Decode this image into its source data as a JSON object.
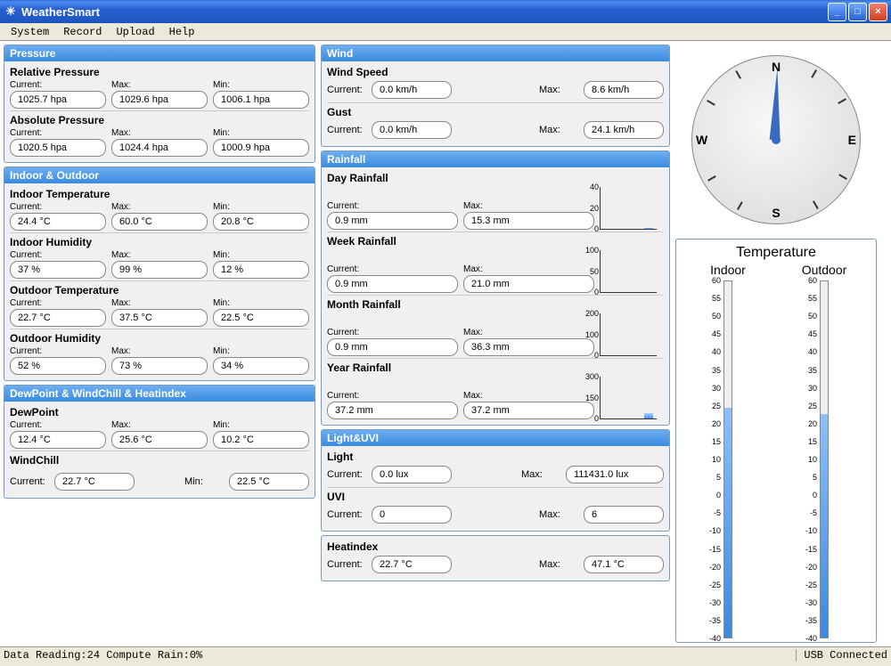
{
  "app": {
    "title": "WeatherSmart"
  },
  "menu": {
    "system": "System",
    "record": "Record",
    "upload": "Upload",
    "help": "Help"
  },
  "labels": {
    "current": "Current:",
    "max": "Max:",
    "min": "Min:"
  },
  "pressure": {
    "header": "Pressure",
    "relative": {
      "title": "Relative Pressure",
      "current": "1025.7 hpa",
      "max": "1029.6 hpa",
      "min": "1006.1 hpa"
    },
    "absolute": {
      "title": "Absolute Pressure",
      "current": "1020.5 hpa",
      "max": "1024.4 hpa",
      "min": "1000.9 hpa"
    }
  },
  "inout": {
    "header": "Indoor & Outdoor",
    "indoor_temp": {
      "title": "Indoor Temperature",
      "current": "24.4 °C",
      "max": "60.0 °C",
      "min": "20.8 °C"
    },
    "indoor_hum": {
      "title": "Indoor Humidity",
      "current": "37 %",
      "max": "99 %",
      "min": "12 %"
    },
    "outdoor_temp": {
      "title": "Outdoor Temperature",
      "current": "22.7 °C",
      "max": "37.5 °C",
      "min": "22.5 °C"
    },
    "outdoor_hum": {
      "title": "Outdoor Humidity",
      "current": "52 %",
      "max": "73 %",
      "min": "34 %"
    }
  },
  "dwh": {
    "header": "DewPoint & WindChill & Heatindex",
    "dewpoint": {
      "title": "DewPoint",
      "current": "12.4 °C",
      "max": "25.6 °C",
      "min": "10.2 °C"
    },
    "windchill": {
      "title": "WindChill",
      "current": "22.7 °C",
      "min": "22.5 °C"
    }
  },
  "wind": {
    "header": "Wind",
    "speed": {
      "title": "Wind Speed",
      "current": "0.0 km/h",
      "max": "8.6 km/h"
    },
    "gust": {
      "title": "Gust",
      "current": "0.0 km/h",
      "max": "24.1 km/h"
    }
  },
  "rainfall": {
    "header": "Rainfall",
    "day": {
      "title": "Day Rainfall",
      "current": "0.9 mm",
      "max": "15.3 mm",
      "scale_top": "40",
      "scale_mid": "20",
      "scale_bot": "0"
    },
    "week": {
      "title": "Week Rainfall",
      "current": "0.9 mm",
      "max": "21.0 mm",
      "scale_top": "100",
      "scale_mid": "50",
      "scale_bot": "0"
    },
    "month": {
      "title": "Month Rainfall",
      "current": "0.9 mm",
      "max": "36.3 mm",
      "scale_top": "200",
      "scale_mid": "100",
      "scale_bot": "0"
    },
    "year": {
      "title": "Year Rainfall",
      "current": "37.2 mm",
      "max": "37.2 mm",
      "scale_top": "300",
      "scale_mid": "150",
      "scale_bot": "0"
    }
  },
  "light": {
    "header": "Light&UVI",
    "light": {
      "title": "Light",
      "current": "0.0 lux",
      "max": "111431.0 lux"
    },
    "uvi": {
      "title": "UVI",
      "current": "0",
      "max": "6"
    }
  },
  "heatindex": {
    "title": "Heatindex",
    "current": "22.7 °C",
    "max": "47.1 °C"
  },
  "compass": {
    "n": "N",
    "s": "S",
    "e": "E",
    "w": "W"
  },
  "temp_panel": {
    "title": "Temperature",
    "indoor_label": "Indoor",
    "outdoor_label": "Outdoor"
  },
  "status": {
    "left": "Data Reading:24 Compute Rain:0%",
    "right": "USB Connected"
  },
  "chart_data": [
    {
      "type": "bar",
      "title": "Day Rainfall",
      "categories": [
        "current"
      ],
      "values": [
        0.9
      ],
      "ylim": [
        0,
        40
      ],
      "ylabel": "mm"
    },
    {
      "type": "bar",
      "title": "Week Rainfall",
      "categories": [
        "current"
      ],
      "values": [
        0.9
      ],
      "ylim": [
        0,
        100
      ],
      "ylabel": "mm"
    },
    {
      "type": "bar",
      "title": "Month Rainfall",
      "categories": [
        "current"
      ],
      "values": [
        0.9
      ],
      "ylim": [
        0,
        200
      ],
      "ylabel": "mm"
    },
    {
      "type": "bar",
      "title": "Year Rainfall",
      "categories": [
        "current"
      ],
      "values": [
        37.2
      ],
      "ylim": [
        0,
        300
      ],
      "ylabel": "mm"
    },
    {
      "type": "bar",
      "title": "Temperature",
      "categories": [
        "Indoor",
        "Outdoor"
      ],
      "values": [
        24.4,
        22.7
      ],
      "ylim": [
        -40,
        60
      ],
      "ylabel": "°C"
    }
  ]
}
